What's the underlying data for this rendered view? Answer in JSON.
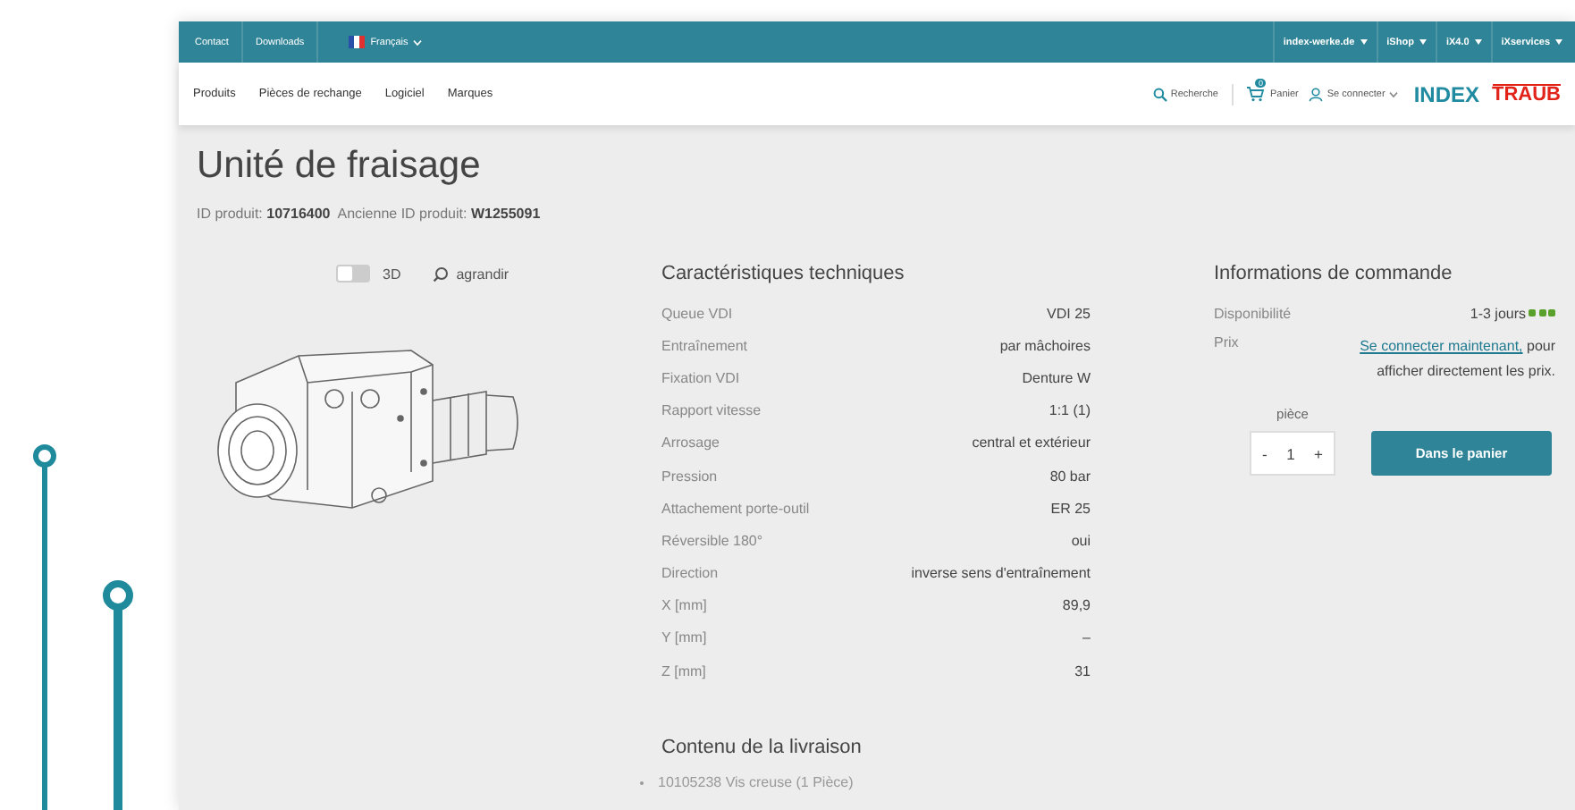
{
  "top_bar": {
    "links": [
      "Contact",
      "Downloads"
    ],
    "language": "Français",
    "menus": [
      "index-werke.de",
      "iShop",
      "iX4.0",
      "iXservices"
    ]
  },
  "nav": {
    "items": [
      "Produits",
      "Pièces de rechange",
      "Logiciel",
      "Marques"
    ],
    "search": "Recherche",
    "cart": {
      "label": "Panier",
      "count": "0"
    },
    "account": "Se connecter",
    "logos": [
      {
        "text": "INDEX",
        "color": "#1f8aa0"
      },
      {
        "text": "TRAUB",
        "color": "#e2231a"
      }
    ]
  },
  "product": {
    "title": "Unité de fraisage",
    "ids": "ID produit: **10716400**  Ancienne ID produit: **W1255091**",
    "view_3d": {
      "label": "3D",
      "on": false
    },
    "zoom": "agrandir"
  },
  "specs": {
    "title": "Caractéristiques techniques",
    "rows": [
      {
        "label": "Queue VDI",
        "value": "VDI 25"
      },
      {
        "label": "Entraînement",
        "value": "par mâchoires"
      },
      {
        "label": "Fixation VDI",
        "value": "Denture W"
      },
      {
        "label": "Rapport vitesse",
        "value": "1:1 (1)"
      },
      {
        "label": "Arrosage",
        "value": "central et extérieur"
      },
      {
        "label": "Pression",
        "value": "80 bar"
      },
      {
        "label": "Attachement porte-outil",
        "value": "ER 25"
      },
      {
        "label": "Réversible 180°",
        "value": "oui"
      },
      {
        "label": "Direction",
        "value": "inverse sens d'entraînement"
      },
      {
        "label": "X [mm]",
        "value": "89,9"
      },
      {
        "label": "Y [mm]",
        "value": "–"
      },
      {
        "label": "Z [mm]",
        "value": "31"
      }
    ]
  },
  "order": {
    "title": "Informations de commande",
    "availability": {
      "label": "Disponibilité",
      "value": "1-3 jours",
      "indicators": [
        {
          "on": true
        },
        {
          "on": true
        },
        {
          "on": true
        }
      ]
    },
    "price": {
      "label": "Prix",
      "link": "Se connecter maintenant,",
      "text": "pour afficher directement les prix."
    },
    "quantity": {
      "unit": "pièce",
      "minus": "-",
      "value": "1",
      "plus": "+"
    },
    "add_button": "Dans le panier"
  },
  "delivery": {
    "title": "Contenu de la livraison",
    "items": [
      "10105238 Vis creuse (1 Pièce)"
    ]
  }
}
